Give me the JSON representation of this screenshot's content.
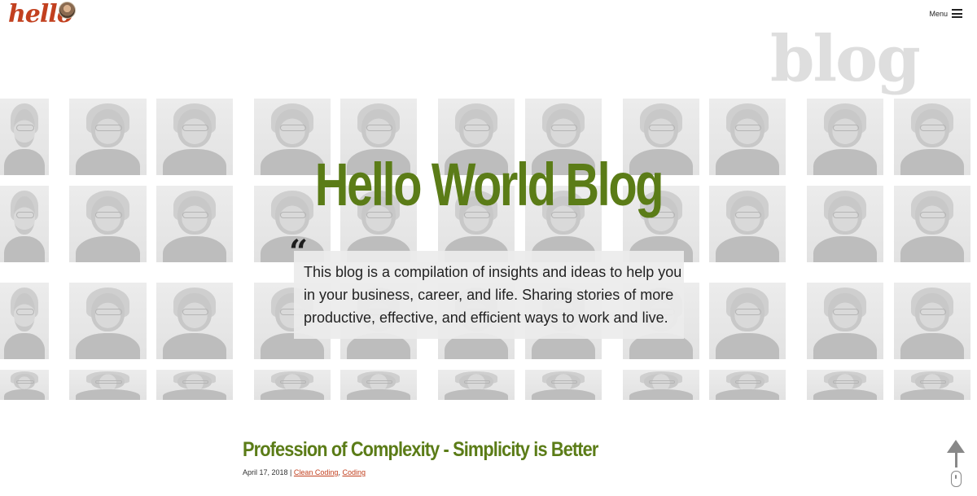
{
  "header": {
    "logo_text": "hello",
    "menu_label": "Menu"
  },
  "hero": {
    "section_label": "blog",
    "title": "Hello World Blog",
    "quote": "This blog is a compilation of insights and ideas to help you in your business, career, and life. Sharing stories of more productive, effective, and efficient ways to work and live."
  },
  "post": {
    "title": "Profession of Complexity - Simplicity is Better",
    "date": "April 17, 2018",
    "separator": " | ",
    "categories": [
      "Clean Coding",
      "Coding"
    ]
  },
  "colors": {
    "accent_green": "#5b7c17",
    "accent_red": "#c2401f"
  }
}
